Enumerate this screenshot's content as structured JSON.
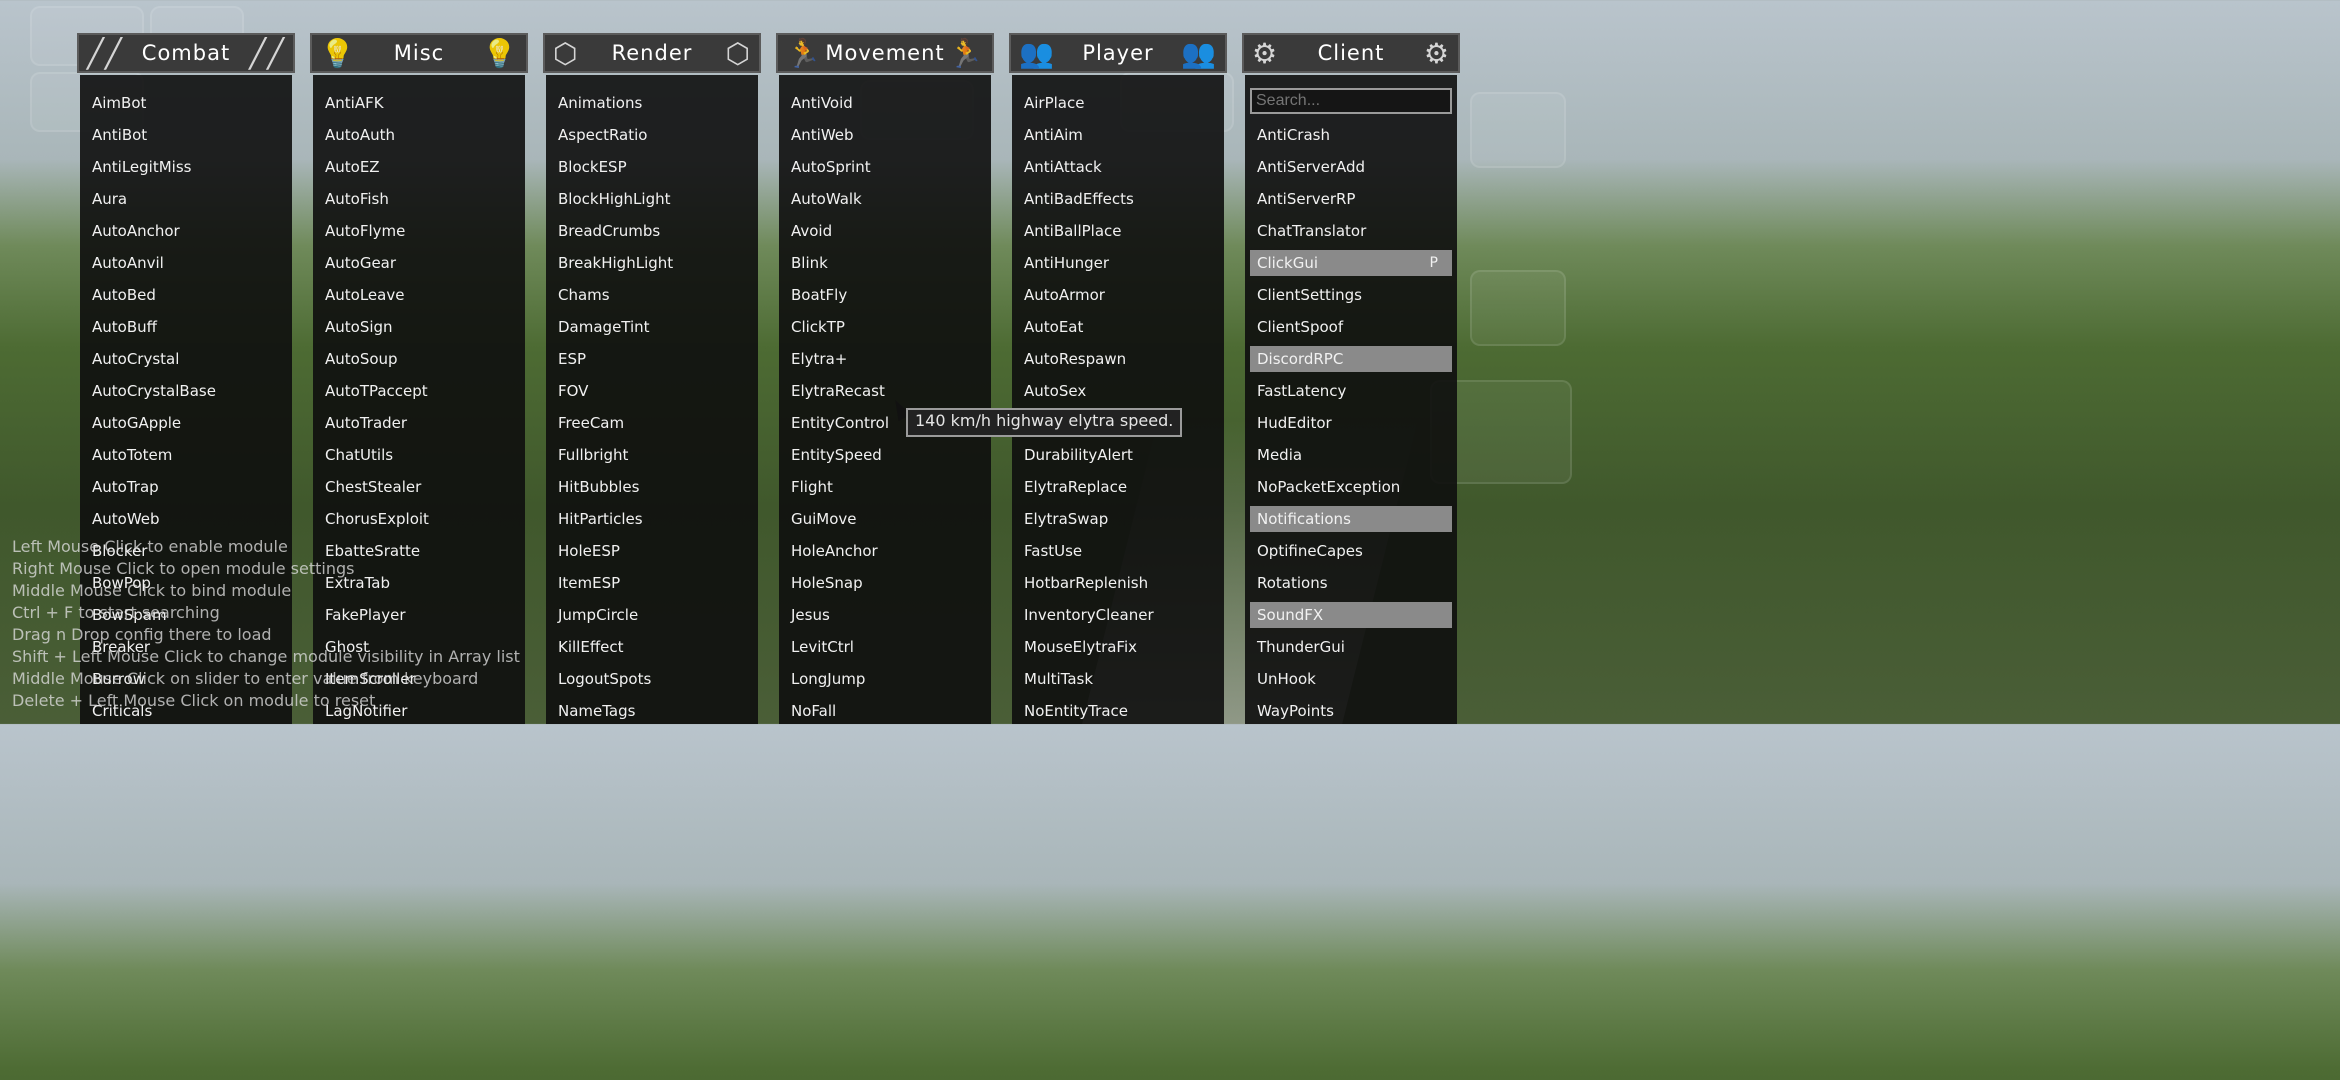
{
  "panels": [
    {
      "name": "Combat",
      "icon": "rifle-icon",
      "modules": [
        {
          "label": "AimBot"
        },
        {
          "label": "AntiBot"
        },
        {
          "label": "AntiLegitMiss"
        },
        {
          "label": "Aura"
        },
        {
          "label": "AutoAnchor"
        },
        {
          "label": "AutoAnvil"
        },
        {
          "label": "AutoBed"
        },
        {
          "label": "AutoBuff"
        },
        {
          "label": "AutoCrystal"
        },
        {
          "label": "AutoCrystalBase"
        },
        {
          "label": "AutoGApple"
        },
        {
          "label": "AutoTotem"
        },
        {
          "label": "AutoTrap"
        },
        {
          "label": "AutoWeb"
        },
        {
          "label": "Blocker"
        },
        {
          "label": "BowPop"
        },
        {
          "label": "BowSpam"
        },
        {
          "label": "Breaker"
        },
        {
          "label": "Burrow"
        },
        {
          "label": "Criticals"
        }
      ]
    },
    {
      "name": "Misc",
      "icon": "lightbulb-icon",
      "modules": [
        {
          "label": "AntiAFK"
        },
        {
          "label": "AutoAuth"
        },
        {
          "label": "AutoEZ"
        },
        {
          "label": "AutoFish"
        },
        {
          "label": "AutoFlyme"
        },
        {
          "label": "AutoGear"
        },
        {
          "label": "AutoLeave"
        },
        {
          "label": "AutoSign"
        },
        {
          "label": "AutoSoup"
        },
        {
          "label": "AutoTPaccept"
        },
        {
          "label": "AutoTrader"
        },
        {
          "label": "ChatUtils"
        },
        {
          "label": "ChestStealer"
        },
        {
          "label": "ChorusExploit"
        },
        {
          "label": "EbatteSratte"
        },
        {
          "label": "ExtraTab"
        },
        {
          "label": "FakePlayer"
        },
        {
          "label": "Ghost"
        },
        {
          "label": "ItemScroller"
        },
        {
          "label": "LagNotifier"
        }
      ]
    },
    {
      "name": "Render",
      "icon": "cube-icon",
      "modules": [
        {
          "label": "Animations"
        },
        {
          "label": "AspectRatio"
        },
        {
          "label": "BlockESP"
        },
        {
          "label": "BlockHighLight"
        },
        {
          "label": "BreadCrumbs"
        },
        {
          "label": "BreakHighLight"
        },
        {
          "label": "Chams"
        },
        {
          "label": "DamageTint"
        },
        {
          "label": "ESP"
        },
        {
          "label": "FOV"
        },
        {
          "label": "FreeCam"
        },
        {
          "label": "Fullbright"
        },
        {
          "label": "HitBubbles"
        },
        {
          "label": "HitParticles"
        },
        {
          "label": "HoleESP"
        },
        {
          "label": "ItemESP"
        },
        {
          "label": "JumpCircle"
        },
        {
          "label": "KillEffect"
        },
        {
          "label": "LogoutSpots"
        },
        {
          "label": "NameTags"
        }
      ]
    },
    {
      "name": "Movement",
      "icon": "running-icon",
      "modules": [
        {
          "label": "AntiVoid"
        },
        {
          "label": "AntiWeb"
        },
        {
          "label": "AutoSprint"
        },
        {
          "label": "AutoWalk"
        },
        {
          "label": "Avoid"
        },
        {
          "label": "Blink"
        },
        {
          "label": "BoatFly"
        },
        {
          "label": "ClickTP"
        },
        {
          "label": "Elytra+"
        },
        {
          "label": "ElytraRecast"
        },
        {
          "label": "EntityControl"
        },
        {
          "label": "EntitySpeed"
        },
        {
          "label": "Flight"
        },
        {
          "label": "GuiMove"
        },
        {
          "label": "HoleAnchor"
        },
        {
          "label": "HoleSnap"
        },
        {
          "label": "Jesus"
        },
        {
          "label": "LevitCtrl"
        },
        {
          "label": "LongJump"
        },
        {
          "label": "NoFall"
        }
      ]
    },
    {
      "name": "Player",
      "icon": "users-icon",
      "modules": [
        {
          "label": "AirPlace"
        },
        {
          "label": "AntiAim"
        },
        {
          "label": "AntiAttack"
        },
        {
          "label": "AntiBadEffects"
        },
        {
          "label": "AntiBallPlace"
        },
        {
          "label": "AntiHunger"
        },
        {
          "label": "AutoArmor"
        },
        {
          "label": "AutoEat"
        },
        {
          "label": "AutoRespawn"
        },
        {
          "label": "AutoSex"
        },
        {
          "label": ""
        },
        {
          "label": "DurabilityAlert"
        },
        {
          "label": "ElytraReplace"
        },
        {
          "label": "ElytraSwap"
        },
        {
          "label": "FastUse"
        },
        {
          "label": "HotbarReplenish"
        },
        {
          "label": "InventoryCleaner"
        },
        {
          "label": "MouseElytraFix"
        },
        {
          "label": "MultiTask"
        },
        {
          "label": "NoEntityTrace"
        }
      ]
    },
    {
      "name": "Client",
      "icon": "gear-icon",
      "search_placeholder": "Search...",
      "modules": [
        {
          "label": "AntiCrash"
        },
        {
          "label": "AntiServerAdd"
        },
        {
          "label": "AntiServerRP"
        },
        {
          "label": "ChatTranslator"
        },
        {
          "label": "ClickGui",
          "enabled": true,
          "key": "P"
        },
        {
          "label": "ClientSettings"
        },
        {
          "label": "ClientSpoof"
        },
        {
          "label": "DiscordRPC",
          "enabled": true
        },
        {
          "label": "FastLatency"
        },
        {
          "label": "HudEditor"
        },
        {
          "label": "Media"
        },
        {
          "label": "NoPacketException"
        },
        {
          "label": "Notifications",
          "enabled": true
        },
        {
          "label": "OptifineCapes"
        },
        {
          "label": "Rotations"
        },
        {
          "label": "SoundFX",
          "enabled": true
        },
        {
          "label": "ThunderGui"
        },
        {
          "label": "UnHook"
        },
        {
          "label": "WayPoints"
        }
      ]
    }
  ],
  "tooltip": "140 km/h highway elytra speed.",
  "help_lines": [
    "Left Mouse Click to enable module",
    "Right Mouse Click to open module settings",
    "Middle Mouse Click to bind module",
    "Ctrl + F to start searching",
    "Drag n Drop config there to load",
    "Shift + Left Mouse Click to change module visibility in Array list",
    "Middle Mouse Click on slider to enter value from keyboard",
    "Delete + Left Mouse Click on module to reset"
  ],
  "colors": {
    "panel_bg": "#0e0e0e",
    "header_bg": "#3a3a3a",
    "enabled_bg": "#8a8a8a",
    "text": "#f1f1f1"
  }
}
